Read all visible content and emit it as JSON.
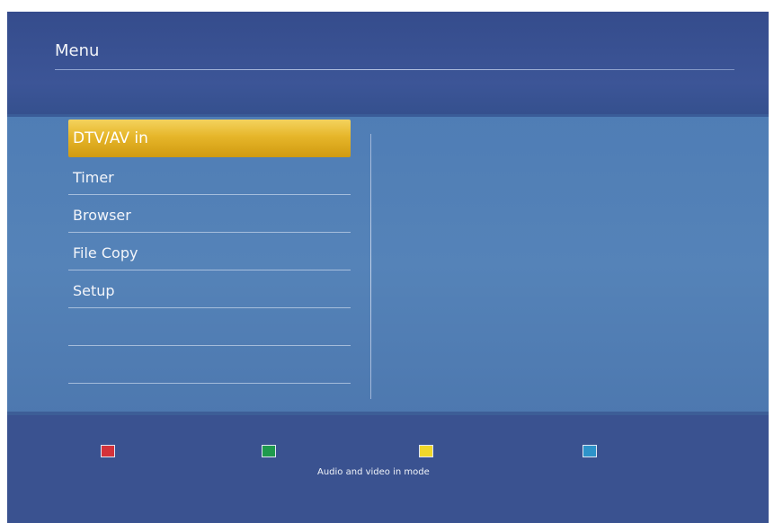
{
  "header": {
    "title": "Menu"
  },
  "menu": {
    "items": [
      {
        "label": "DTV/AV in",
        "selected": true
      },
      {
        "label": "Timer",
        "selected": false
      },
      {
        "label": "Browser",
        "selected": false
      },
      {
        "label": "File Copy",
        "selected": false
      },
      {
        "label": "Setup",
        "selected": false
      },
      {
        "label": "",
        "selected": false
      },
      {
        "label": "",
        "selected": false
      }
    ]
  },
  "footer": {
    "keys": [
      {
        "name": "red",
        "color": "#d4323a"
      },
      {
        "name": "green",
        "color": "#1f9a4d"
      },
      {
        "name": "yellow",
        "color": "#efd72a"
      },
      {
        "name": "blue",
        "color": "#2d93c9"
      }
    ],
    "hint": "Audio and video in mode"
  }
}
